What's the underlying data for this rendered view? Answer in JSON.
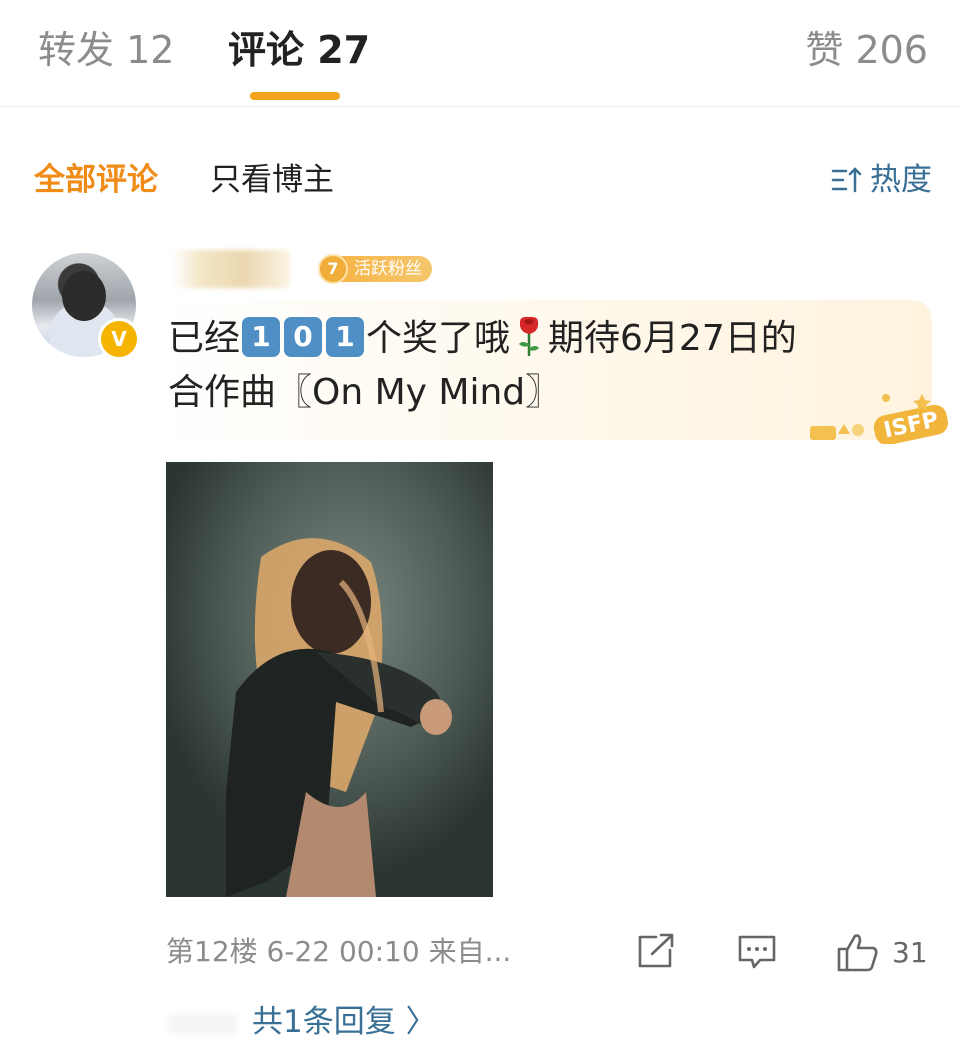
{
  "tabs": {
    "repost": "转发 12",
    "comments": "评论 27",
    "likes": "赞 206"
  },
  "filters": {
    "all": "全部评论",
    "author_only": "只看博主",
    "sort": "热度"
  },
  "comment": {
    "fan_badge_level": "7",
    "fan_badge_label": "活跃粉丝",
    "text_before": "已经",
    "digits": [
      "1",
      "0",
      "1"
    ],
    "text_after": "个奖了哦",
    "text_after_rose": "期待6月27日的",
    "line2": "合作曲〖On My Mind〗",
    "meta": "第12楼 6-22 00:10 来自...",
    "like_count": "31",
    "replies": "共1条回复 〉",
    "badge_text": "ISFP"
  },
  "icons": {
    "verified": "verified-badge-icon",
    "sort": "sort-icon",
    "share": "share-icon",
    "reply": "comment-icon",
    "like": "thumbs-up-icon",
    "rose": "rose-icon"
  },
  "colors": {
    "accent_orange": "#f08b18",
    "link_blue": "#3a6f96",
    "number_key_blue": "#4f8fc5"
  }
}
